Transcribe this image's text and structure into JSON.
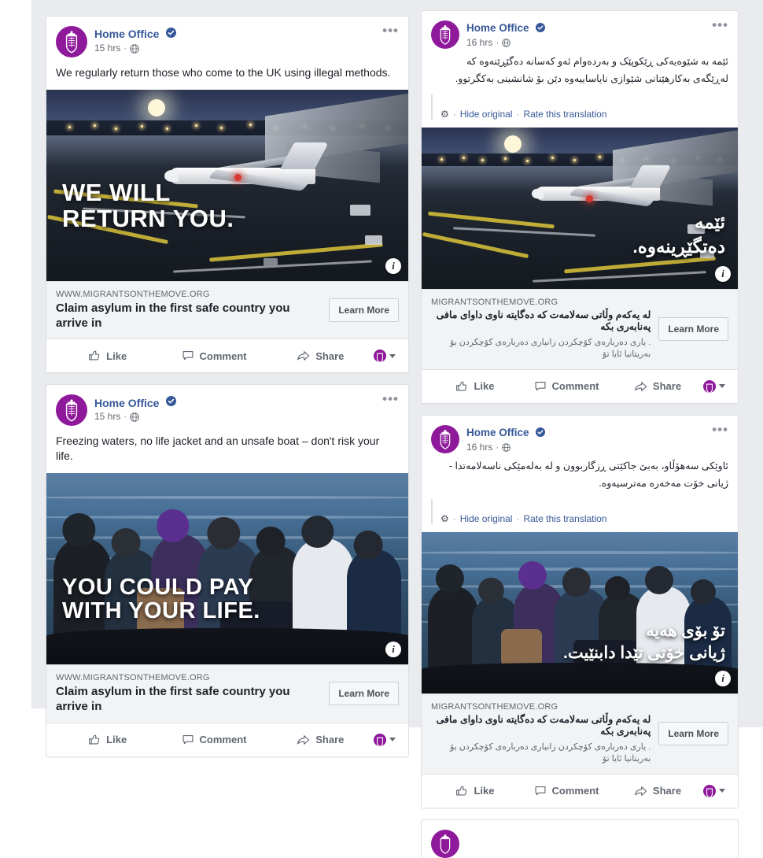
{
  "page": {
    "background_color": "#ffffff",
    "gutter_color": "#e9ebee",
    "brand_purple": "#8f199b",
    "link_blue": "#365899"
  },
  "common": {
    "page_name": "Home Office",
    "verified_badge": "verified-badge-icon",
    "privacy_icon": "globe-icon",
    "more_options": "•••",
    "dot": "·",
    "like_label": "Like",
    "comment_label": "Comment",
    "share_label": "Share",
    "learn_more_label": "Learn More",
    "info_badge": "i",
    "hide_original_label": "Hide original",
    "rate_translation_label": "Rate this translation",
    "gear_icon": "⚙"
  },
  "posts": [
    {
      "column": "left",
      "page_name": "Home Office",
      "timestamp": "15 hrs",
      "body": "We regularly return those who come to the UK using illegal methods.",
      "image_overlay_line1": "WE WILL",
      "image_overlay_line2": "RETURN YOU.",
      "image_alt": "night-airport-tarmac-photo",
      "link_domain": "WWW.MIGRANTSONTHEMOVE.ORG",
      "link_title": "Claim asylum in the first safe country you arrive in",
      "link_description": "",
      "learn_more": "Learn More",
      "like": "Like",
      "comment": "Comment",
      "share": "Share"
    },
    {
      "column": "right",
      "page_name": "Home Office",
      "timestamp": "16 hrs",
      "body": "ئێمە بە شێوەیەکی ڕێکوپێک و بەردەوام ئەو کەسانە دەگێڕێنەوە کە لەڕێگەی بەکارهێنانی شێوازی نایاساییەوە دێن بۆ شانشینی بەکگرتوو.",
      "hide_original": "Hide original",
      "rate_translation": "Rate this translation",
      "image_overlay_line1": "ئێمە",
      "image_overlay_line2": "دەتگێڕینەوە.",
      "image_alt": "night-airport-tarmac-photo",
      "link_domain": "MIGRANTSONTHEMOVE.ORG",
      "link_title": "لە یەکەم وڵاتی سەلامەت کە دەگایتە ناوی داوای مافی پەنابەری بکە",
      "link_description": ". یاری دەربارەی کۆچکردن زانیاری دەربارەی کۆچکردن بۆ بەریتانیا ئایا تۆ",
      "learn_more": "Learn More",
      "like": "Like",
      "comment": "Comment",
      "share": "Share"
    },
    {
      "column": "left",
      "page_name": "Home Office",
      "timestamp": "15 hrs",
      "body": "Freezing waters, no life jacket and an unsafe boat – don't risk your life.",
      "image_overlay_line1": "YOU COULD PAY",
      "image_overlay_line2": "WITH YOUR LIFE.",
      "image_alt": "migrants-in-dinghy-at-sea-photo",
      "link_domain": "WWW.MIGRANTSONTHEMOVE.ORG",
      "link_title": "Claim asylum in the first safe country you arrive in",
      "link_description": "",
      "learn_more": "Learn More",
      "like": "Like",
      "comment": "Comment",
      "share": "Share"
    },
    {
      "column": "right",
      "page_name": "Home Office",
      "timestamp": "16 hrs",
      "body": "ئاوێکی سەهۆڵاو، بەبێ جاکێتی ڕزگاربوون و لە بەلەمێکی ناسەلامەتدا - ژیانی خۆت مەخەرە مەترسیەوە.",
      "hide_original": "Hide original",
      "rate_translation": "Rate this translation",
      "image_overlay_line1": "تۆ بۆی هەیە",
      "image_overlay_line2": "ژیانی خۆتی تێدا دابنێیت.",
      "image_alt": "migrants-in-dinghy-at-sea-photo",
      "link_domain": "MIGRANTSONTHEMOVE.ORG",
      "link_title": "لە یەکەم وڵاتی سەلامەت کە دەگایتە ناوی داوای مافی پەنابەری بکە",
      "link_description": ". یاری دەربارەی کۆچکردن زانیاری دەربارەی کۆچکردن بۆ بەریتانیا ئایا تۆ",
      "learn_more": "Learn More",
      "like": "Like",
      "comment": "Comment",
      "share": "Share"
    },
    {
      "column": "right",
      "page_name": "Home Office",
      "timestamp": "",
      "body": "",
      "partial": true
    }
  ]
}
